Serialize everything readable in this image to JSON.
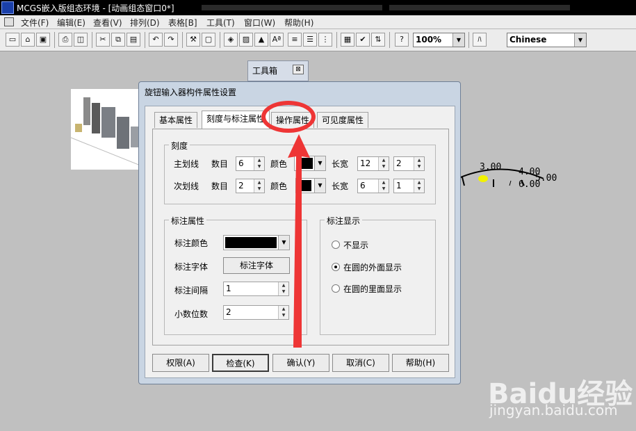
{
  "window": {
    "title": "MCGS嵌入版组态环境 - [动画组态窗口0*]"
  },
  "menu": [
    "文件(F)",
    "编辑(E)",
    "查看(V)",
    "排列(D)",
    "表格[B]",
    "工具(T)",
    "窗口(W)",
    "帮助(H)"
  ],
  "toolbar": {
    "zoom_value": "100%",
    "language_value": "Chinese"
  },
  "toolbox": {
    "title": "工具箱",
    "close": "⊠"
  },
  "gauge": {
    "labels": [
      "3.00",
      "4.00",
      "5.00",
      "6.00"
    ]
  },
  "dialog": {
    "title": "旋钮输入器构件属性设置",
    "tabs": [
      "基本属性",
      "刻度与标注属性",
      "操作属性",
      "可见度属性"
    ],
    "scale": {
      "group_label": "刻度",
      "major": {
        "label": "主划线",
        "count_label": "数目",
        "count": "6",
        "color_label": "颜色",
        "size_label": "长宽",
        "length": "12",
        "width": "2"
      },
      "minor": {
        "label": "次划线",
        "count_label": "数目",
        "count": "2",
        "color_label": "颜色",
        "size_label": "长宽",
        "length": "6",
        "width": "1"
      }
    },
    "annotation": {
      "group_label": "标注属性",
      "color_label": "标注颜色",
      "font_label": "标注字体",
      "font_button": "标注字体",
      "interval_label": "标注间隔",
      "interval": "1",
      "decimals_label": "小数位数",
      "decimals": "2"
    },
    "display": {
      "group_label": "标注显示",
      "options": [
        "不显示",
        "在圆的外面显示",
        "在圆的里面显示"
      ],
      "selected_index": 1
    },
    "buttons": [
      "权限(A)",
      "检查(K)",
      "确认(Y)",
      "取消(C)",
      "帮助(H)"
    ]
  },
  "watermark": {
    "brand": "Baidu经验",
    "url": "jingyan.baidu.com"
  },
  "colors": {
    "annotation_red": "#ee3535"
  }
}
